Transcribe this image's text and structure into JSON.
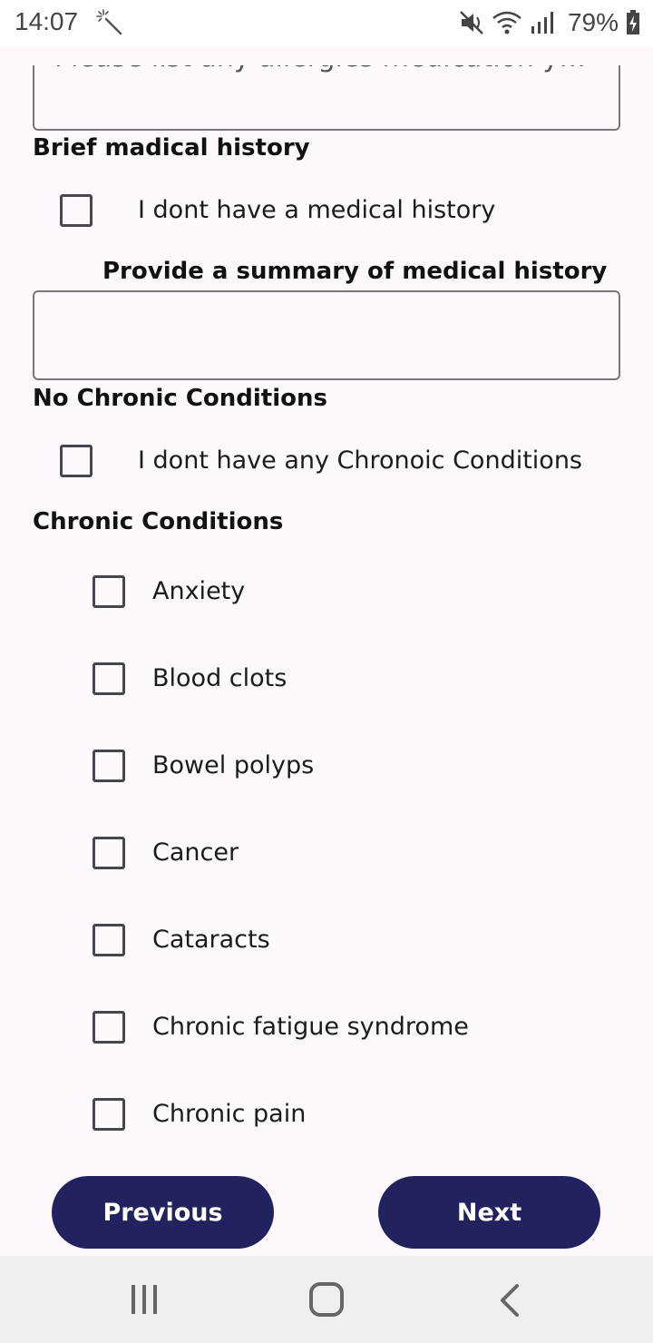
{
  "status_bar": {
    "time": "14:07",
    "battery": "79%",
    "icons": [
      "magic-wand-icon",
      "mute-icon",
      "wifi-icon",
      "signal-icon",
      "battery-charging-icon"
    ]
  },
  "form": {
    "allergies_value": "Please list any allergies medication y…",
    "medical_history": {
      "heading": "Brief madical history",
      "no_history_label": "I dont have a medical history",
      "no_history_checked": false,
      "summary_heading": "Provide a summary of medical history",
      "summary_value": ""
    },
    "no_chronic": {
      "heading": "No Chronic Conditions",
      "label": "I dont have any Chronoic Conditions",
      "checked": false
    },
    "chronic": {
      "heading": "Chronic Conditions",
      "options": [
        {
          "label": "Anxiety",
          "checked": false
        },
        {
          "label": "Blood clots",
          "checked": false
        },
        {
          "label": "Bowel polyps",
          "checked": false
        },
        {
          "label": "Cancer",
          "checked": false
        },
        {
          "label": "Cataracts",
          "checked": false
        },
        {
          "label": "Chronic fatigue syndrome",
          "checked": false
        },
        {
          "label": "Chronic pain",
          "checked": false
        }
      ]
    }
  },
  "buttons": {
    "previous": "Previous",
    "next": "Next"
  },
  "colors": {
    "button_bg": "#22225f",
    "page_bg": "#fdf8fc",
    "checkbox_border": "#49454f"
  },
  "system_nav": [
    "recent-apps-icon",
    "home-icon",
    "back-icon"
  ]
}
